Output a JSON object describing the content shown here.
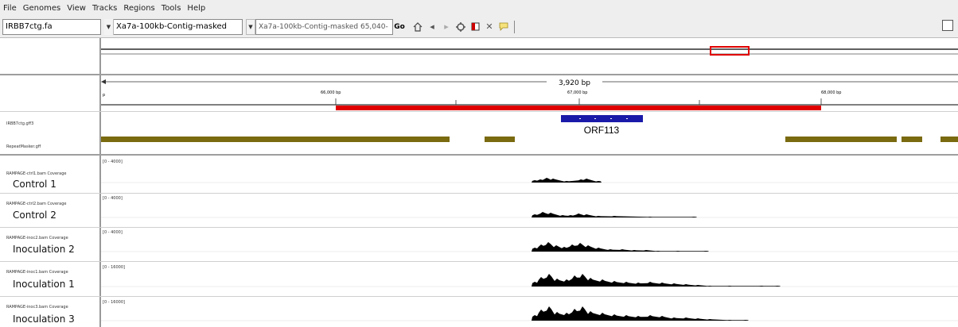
{
  "menu": {
    "items": [
      "File",
      "Genomes",
      "View",
      "Tracks",
      "Regions",
      "Tools",
      "Help"
    ]
  },
  "toolbar": {
    "genome_value": "IRBB7ctg.fa",
    "chromosome_value": "Xa7a-100kb-Contig-masked",
    "locus_value": "Xa7a-100kb-Contig-masked 65,040-",
    "go_label": "Go",
    "icons": [
      "home-icon",
      "back-icon",
      "forward-icon",
      "refresh-icon",
      "roi-icon",
      "close-icon",
      "popup-icon"
    ]
  },
  "ruler": {
    "span_label": "3,920 bp",
    "ticks": [
      "66,000 bp",
      "67,000 bp",
      "68,000 bp"
    ],
    "left_tick": "p"
  },
  "annotation_tracks": [
    {
      "name": "IRBB7ctg.gff3"
    },
    {
      "name": "RepeatMasker.gff"
    }
  ],
  "gene": {
    "label": "ORF113"
  },
  "coverage_tracks": [
    {
      "name": "RAMPAGE-ctrl1.bam Coverage",
      "sample": "Control 1",
      "range": "[0 - 4000]"
    },
    {
      "name": "RAMPAGE-ctrl2.bam Coverage",
      "sample": "Control 2",
      "range": "[0 - 4000]"
    },
    {
      "name": "RAMPAGE-inoc2.bam Coverage",
      "sample": "Inoculation 2",
      "range": "[0 - 4000]"
    },
    {
      "name": "RAMPAGE-inoc1.bam Coverage",
      "sample": "Inoculation 1",
      "range": "[0 - 16000]"
    },
    {
      "name": "RAMPAGE-inoc3.bam Coverage",
      "sample": "Inoculation 3",
      "range": "[0 - 16000]"
    }
  ],
  "colors": {
    "ideogram_box": "#e00000",
    "roi_bar": "#e00000",
    "gene_feature": "#1a1aa8",
    "repeat_feature": "#7a6a10",
    "coverage": "#000000"
  }
}
